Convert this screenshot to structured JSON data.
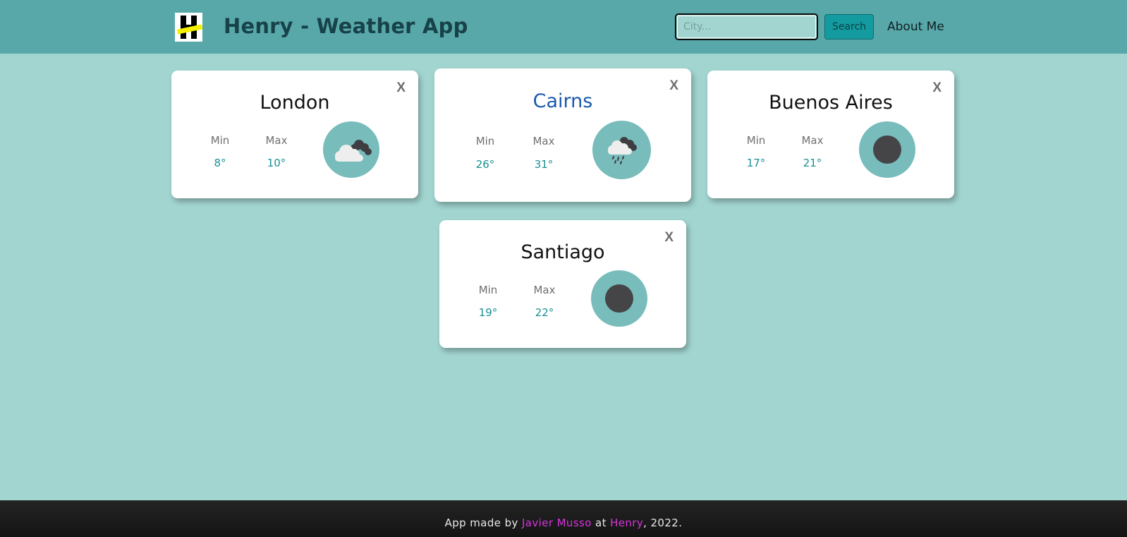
{
  "header": {
    "title": "Henry - Weather App",
    "search": {
      "placeholder": "City...",
      "value": ""
    },
    "search_label": "Search",
    "about_label": "About Me"
  },
  "labels": {
    "min": "Min",
    "max": "Max",
    "close": "X"
  },
  "cards": [
    {
      "city": "London",
      "min": "8°",
      "max": "10°",
      "icon": "cloudy-icon"
    },
    {
      "city": "Cairns",
      "min": "26°",
      "max": "31°",
      "icon": "rain-icon"
    },
    {
      "city": "Buenos Aires",
      "min": "17°",
      "max": "21°",
      "icon": "dark-circle-icon"
    },
    {
      "city": "Santiago",
      "min": "19°",
      "max": "22°",
      "icon": "dark-circle-icon"
    }
  ],
  "footer": {
    "prefix": "App made by",
    "author": "Javier Musso",
    "middle": "at",
    "org": "Henry",
    "suffix": ", 2022."
  },
  "colors": {
    "background": "#a2d5d0",
    "navbar": "#59a8a9",
    "accent": "#139b9f",
    "link": "#d634dc",
    "icon_bg": "#78bcbc"
  }
}
